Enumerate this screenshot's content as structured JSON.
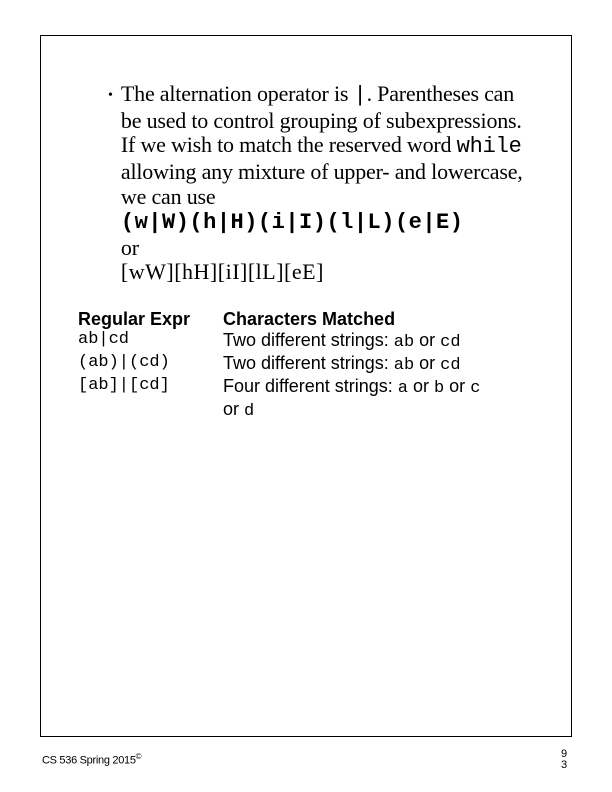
{
  "bullet": "•",
  "para": {
    "line1a": "The alternation operator is ",
    "pipe": "|",
    "line1b": ". Parentheses can be used to control grouping of subexpressions.",
    "line2a": "If we wish to match the reserved word ",
    "while": "while",
    "line2b": " allowing any mixture of upper- and lowercase, we can use",
    "pattern1": "(w|W)(h|H)(i|I)(l|L)(e|E)",
    "or": "or",
    "pattern2": "[wW][hH][iI][lL][eE]"
  },
  "table": {
    "h1": "Regular Expr",
    "h2": "Characters Matched",
    "r1c1": "ab|cd",
    "r1c2a": "Two different strings: ",
    "r1c2b": "ab",
    "r1c2c": " or ",
    "r1c2d": "cd",
    "r2c1": "(ab)|(cd)",
    "r2c2a": "Two different strings: ",
    "r2c2b": "ab",
    "r2c2c": " or ",
    "r2c2d": "cd",
    "r3c1": "[ab]|[cd]",
    "r3c2a": "Four different strings: ",
    "r3c2b": "a",
    "r3c2c": " or ",
    "r3c2d": "b",
    "r3c2e": " or ",
    "r3c2f": "c",
    "r3c2g": " or ",
    "r3c2h": "d"
  },
  "footer": {
    "left": "CS 536  Spring 2015",
    "copy": "©",
    "pageA": "9",
    "pageB": "3"
  }
}
